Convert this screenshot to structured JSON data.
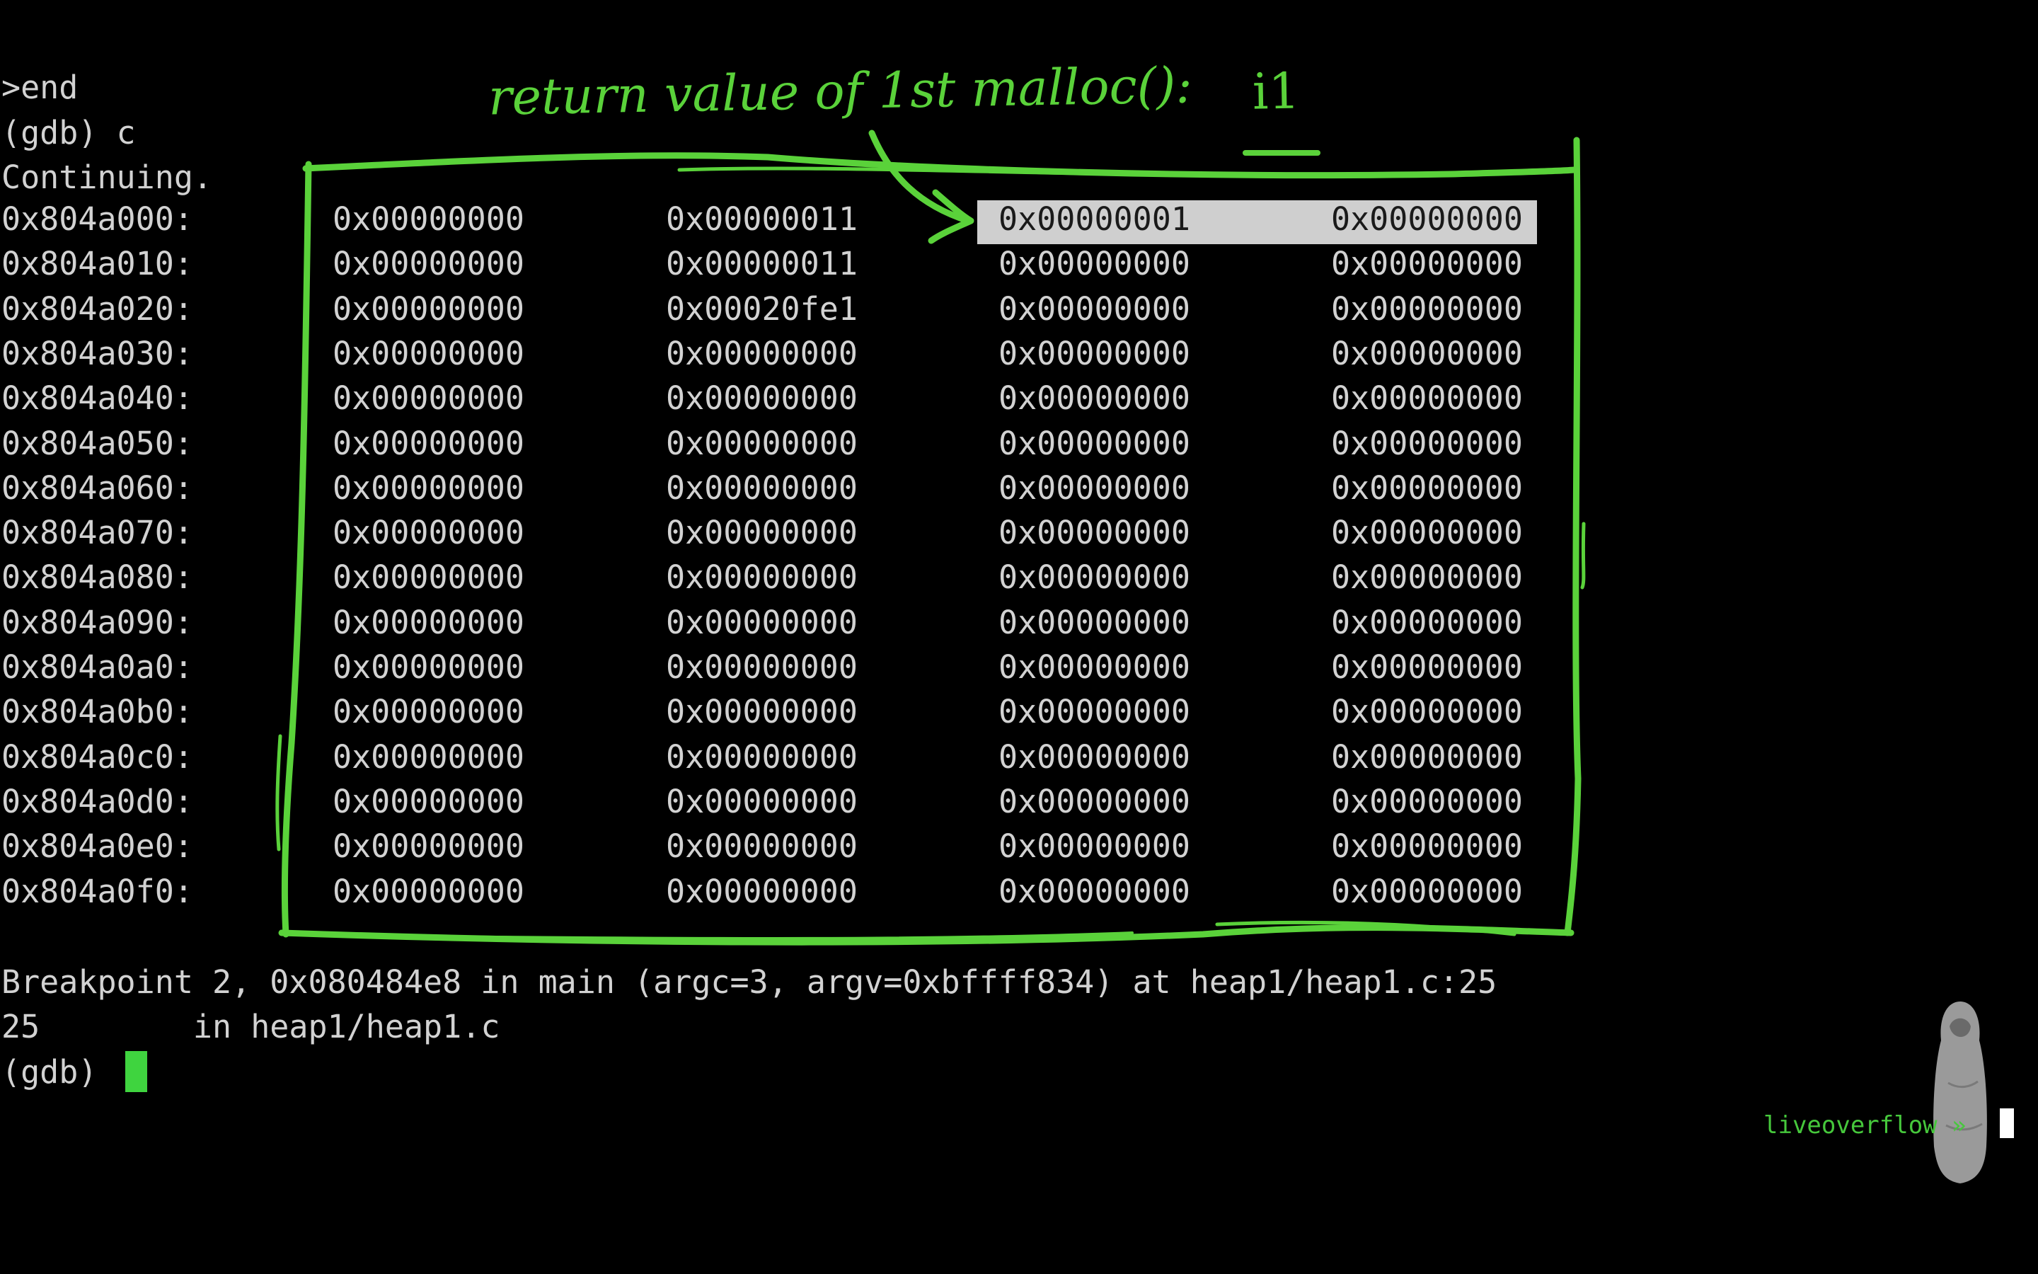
{
  "terminal": {
    "pre_lines": [
      ">end",
      "(gdb) c",
      "Continuing."
    ],
    "memory_rows": [
      {
        "addr": "0x804a000:",
        "words": [
          "0x00000000",
          "0x00000011",
          "0x00000001",
          "0x00000000"
        ]
      },
      {
        "addr": "0x804a010:",
        "words": [
          "0x00000000",
          "0x00000011",
          "0x00000000",
          "0x00000000"
        ]
      },
      {
        "addr": "0x804a020:",
        "words": [
          "0x00000000",
          "0x00020fe1",
          "0x00000000",
          "0x00000000"
        ]
      },
      {
        "addr": "0x804a030:",
        "words": [
          "0x00000000",
          "0x00000000",
          "0x00000000",
          "0x00000000"
        ]
      },
      {
        "addr": "0x804a040:",
        "words": [
          "0x00000000",
          "0x00000000",
          "0x00000000",
          "0x00000000"
        ]
      },
      {
        "addr": "0x804a050:",
        "words": [
          "0x00000000",
          "0x00000000",
          "0x00000000",
          "0x00000000"
        ]
      },
      {
        "addr": "0x804a060:",
        "words": [
          "0x00000000",
          "0x00000000",
          "0x00000000",
          "0x00000000"
        ]
      },
      {
        "addr": "0x804a070:",
        "words": [
          "0x00000000",
          "0x00000000",
          "0x00000000",
          "0x00000000"
        ]
      },
      {
        "addr": "0x804a080:",
        "words": [
          "0x00000000",
          "0x00000000",
          "0x00000000",
          "0x00000000"
        ]
      },
      {
        "addr": "0x804a090:",
        "words": [
          "0x00000000",
          "0x00000000",
          "0x00000000",
          "0x00000000"
        ]
      },
      {
        "addr": "0x804a0a0:",
        "words": [
          "0x00000000",
          "0x00000000",
          "0x00000000",
          "0x00000000"
        ]
      },
      {
        "addr": "0x804a0b0:",
        "words": [
          "0x00000000",
          "0x00000000",
          "0x00000000",
          "0x00000000"
        ]
      },
      {
        "addr": "0x804a0c0:",
        "words": [
          "0x00000000",
          "0x00000000",
          "0x00000000",
          "0x00000000"
        ]
      },
      {
        "addr": "0x804a0d0:",
        "words": [
          "0x00000000",
          "0x00000000",
          "0x00000000",
          "0x00000000"
        ]
      },
      {
        "addr": "0x804a0e0:",
        "words": [
          "0x00000000",
          "0x00000000",
          "0x00000000",
          "0x00000000"
        ]
      },
      {
        "addr": "0x804a0f0:",
        "words": [
          "0x00000000",
          "0x00000000",
          "0x00000000",
          "0x00000000"
        ]
      }
    ],
    "post_lines": [
      "Breakpoint 2, 0x080484e8 in main (argc=3, argv=0xbffff834) at heap1/heap1.c:25",
      "25\t  in heap1/heap1.c",
      "(gdb) "
    ]
  },
  "annotation": {
    "text": "return value of 1st malloc():",
    "var": "i1",
    "color": "#5ad23a"
  },
  "branding": {
    "channel": "liveoverflow »"
  },
  "colors": {
    "background": "#000000",
    "text": "#d2d2d2",
    "highlight": "#cfcfcf",
    "annotation_green": "#5ad23a"
  }
}
